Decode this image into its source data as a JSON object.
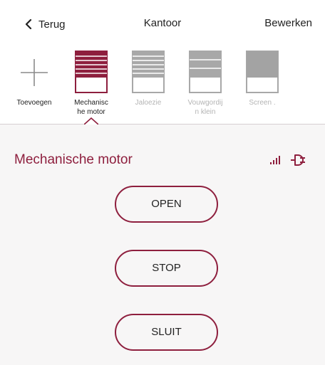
{
  "nav": {
    "back_label": "Terug",
    "title": "Kantoor",
    "edit_label": "Bewerken"
  },
  "devices": [
    {
      "label": "Toevoegen",
      "icon": "plus-icon",
      "active": false
    },
    {
      "label": "Mechanisc\nhe motor",
      "icon": "blind-icon",
      "active": true
    },
    {
      "label": "Jaloezie",
      "icon": "blind-icon",
      "active": false
    },
    {
      "label": "Vouwgordij\nn  klein",
      "icon": "blind-icon",
      "active": false
    },
    {
      "label": "Screen .",
      "icon": "screen-icon",
      "active": false
    }
  ],
  "panel": {
    "device_title": "Mechanische motor",
    "signal_icon": "signal-icon",
    "power_icon": "plug-icon",
    "buttons": {
      "open": "OPEN",
      "stop": "STOP",
      "close": "SLUIT"
    }
  },
  "colors": {
    "accent": "#8e1f3e",
    "inactive_icon": "#a8a8a8",
    "inactive_label": "#b4b4b4",
    "panel_bg": "#f7f6f6"
  }
}
